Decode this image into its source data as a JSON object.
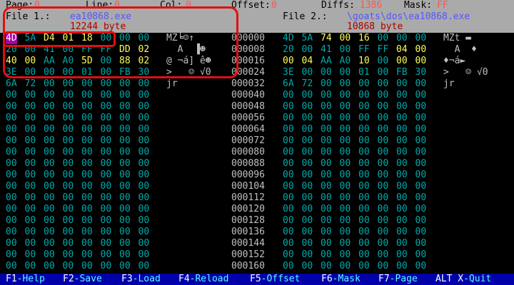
{
  "status_bar": {
    "page": {
      "label": "Page:",
      "value": "0"
    },
    "line": {
      "label": "Line:",
      "value": "0"
    },
    "col": {
      "label": "Col:",
      "value": "0"
    },
    "offset": {
      "label": "Offset:",
      "value": "0"
    },
    "diffs": {
      "label": "Diffs:",
      "value": "1386"
    },
    "mask": {
      "label": "Mask:",
      "value": "FF"
    }
  },
  "files": {
    "file1": {
      "label": "File 1.:",
      "name": "ea10868.exe",
      "size": "12244 byte"
    },
    "file2": {
      "label": "File 2.:",
      "name": "\\goats\\dos\\ea10868.exe",
      "size": "10868 byte"
    }
  },
  "colors": {
    "background": "#000000",
    "panel_gray": "#aaaaaa",
    "hex_cyan": "#00aaaa",
    "diff_yellow": "#ffff55",
    "function_bar": "#0000aa",
    "annotation_red": "#e01010"
  },
  "rows": [
    {
      "offset": "000000",
      "left": {
        "hex": [
          "4D",
          "5A",
          "D4",
          "01",
          "18",
          "00",
          "00",
          "00"
        ],
        "diff": [
          0,
          0,
          1,
          1,
          1,
          0,
          0,
          0
        ],
        "ascii": "MZ╘☺↑"
      },
      "right": {
        "hex": [
          "4D",
          "5A",
          "74",
          "00",
          "16",
          "00",
          "00",
          "00"
        ],
        "diff": [
          0,
          0,
          1,
          1,
          1,
          0,
          0,
          0
        ],
        "ascii": "MZt ▬"
      }
    },
    {
      "offset": "000008",
      "left": {
        "hex": [
          "20",
          "00",
          "41",
          "00",
          "FF",
          "FF",
          "DD",
          "02"
        ],
        "diff": [
          0,
          0,
          0,
          0,
          0,
          0,
          1,
          1
        ],
        "ascii": "  A  ▐☻"
      },
      "right": {
        "hex": [
          "20",
          "00",
          "41",
          "00",
          "FF",
          "FF",
          "04",
          "00"
        ],
        "diff": [
          0,
          0,
          0,
          0,
          0,
          0,
          1,
          1
        ],
        "ascii": "  A  ♦"
      }
    },
    {
      "offset": "000016",
      "left": {
        "hex": [
          "40",
          "00",
          "AA",
          "A0",
          "5D",
          "00",
          "88",
          "02"
        ],
        "diff": [
          1,
          1,
          0,
          0,
          1,
          0,
          1,
          1
        ],
        "ascii": "@ ¬á] ê☻"
      },
      "right": {
        "hex": [
          "00",
          "04",
          "AA",
          "A0",
          "10",
          "00",
          "00",
          "00"
        ],
        "diff": [
          1,
          1,
          0,
          0,
          1,
          0,
          1,
          1
        ],
        "ascii": "♦¬á►"
      }
    },
    {
      "offset": "000024",
      "left": {
        "hex": [
          "3E",
          "00",
          "00",
          "00",
          "01",
          "00",
          "FB",
          "30"
        ],
        "diff": [
          0,
          0,
          0,
          0,
          0,
          0,
          0,
          0
        ],
        "ascii": ">   ☺ √0"
      },
      "right": {
        "hex": [
          "3E",
          "00",
          "00",
          "00",
          "01",
          "00",
          "FB",
          "30"
        ],
        "diff": [
          0,
          0,
          0,
          0,
          0,
          0,
          0,
          0
        ],
        "ascii": ">   ☺ √0"
      }
    },
    {
      "offset": "000032",
      "left": {
        "hex": [
          "6A",
          "72",
          "00",
          "00",
          "00",
          "00",
          "00",
          "00"
        ],
        "diff": [
          0,
          0,
          0,
          0,
          0,
          0,
          0,
          0
        ],
        "ascii": "jr"
      },
      "right": {
        "hex": [
          "6A",
          "72",
          "00",
          "00",
          "00",
          "00",
          "00",
          "00"
        ],
        "diff": [
          0,
          0,
          0,
          0,
          0,
          0,
          0,
          0
        ],
        "ascii": "jr"
      }
    },
    {
      "offset": "000040"
    },
    {
      "offset": "000048"
    },
    {
      "offset": "000056"
    },
    {
      "offset": "000064"
    },
    {
      "offset": "000072"
    },
    {
      "offset": "000080"
    },
    {
      "offset": "000088"
    },
    {
      "offset": "000096"
    },
    {
      "offset": "000104"
    },
    {
      "offset": "000112"
    },
    {
      "offset": "000120"
    },
    {
      "offset": "000128"
    },
    {
      "offset": "000136"
    },
    {
      "offset": "000144"
    },
    {
      "offset": "000152"
    },
    {
      "offset": "000160"
    }
  ],
  "empty_hex": "00",
  "function_keys": [
    {
      "key": "F1",
      "label": "Help"
    },
    {
      "key": "F2",
      "label": "Save"
    },
    {
      "key": "F3",
      "label": "Load"
    },
    {
      "key": "F4",
      "label": "Reload"
    },
    {
      "key": "F5",
      "label": "Offset"
    },
    {
      "key": "F6",
      "label": "Mask"
    },
    {
      "key": "F7",
      "label": "Page"
    },
    {
      "key": "ALT X",
      "label": "Quit"
    }
  ]
}
